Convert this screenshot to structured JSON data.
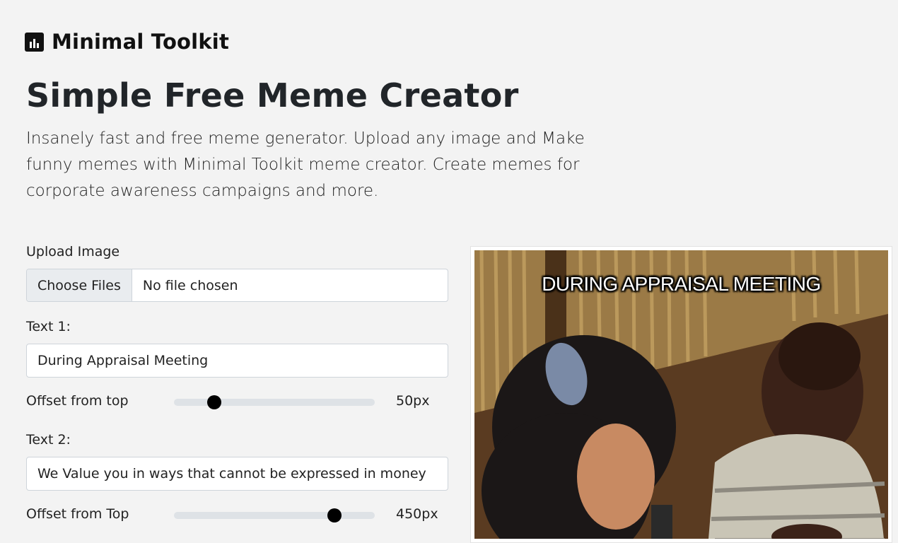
{
  "brand": {
    "name": "Minimal Toolkit",
    "logo_icon": "bar-chart-icon"
  },
  "page": {
    "title": "Simple Free Meme Creator",
    "description": "Insanely fast and free meme generator. Upload any image and Make funny memes with Minimal Toolkit meme creator. Create memes for corporate awareness campaigns and more."
  },
  "form": {
    "upload_label": "Upload Image",
    "file_button": "Choose Files",
    "file_status": "No file chosen",
    "text1_label": "Text 1:",
    "text1_value": "During Appraisal Meeting",
    "offset1_label": "Offset from top",
    "offset1_value": 50,
    "offset1_display": "50px",
    "text2_label": "Text 2:",
    "text2_value": "We Value you in ways that cannot be expressed in money",
    "offset2_label": "Offset from Top",
    "offset2_value": 450,
    "offset2_display": "450px",
    "offset_max": 500
  },
  "preview": {
    "caption_top": "DURING APPRAISAL MEETING"
  }
}
